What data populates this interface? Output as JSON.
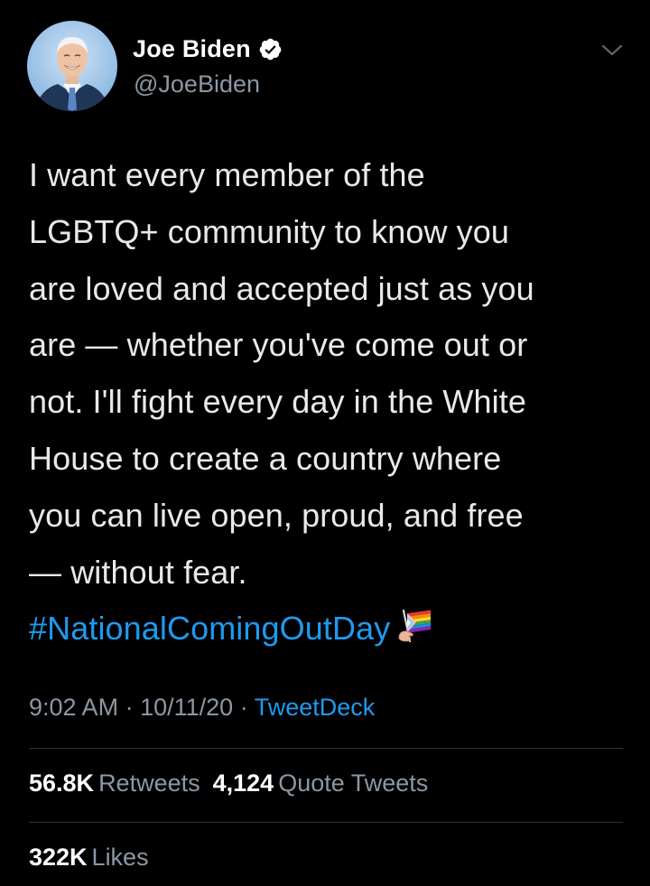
{
  "author": {
    "display_name": "Joe Biden",
    "handle": "@JoeBiden",
    "verified_icon": "verified-badge-icon",
    "more_icon": "chevron-down-icon"
  },
  "tweet": {
    "lines": [
      "I want every member of the",
      "LGBTQ+ community to know you",
      "are loved and accepted just as you",
      "are — whether you've come out or",
      "not. I'll fight every day in the White",
      "House to create a country where",
      "you can live open, proud, and free",
      "— without fear."
    ],
    "hashtag": "#NationalComingOutDay",
    "emoji": "progress-pride-flag-emoji"
  },
  "meta": {
    "time": "9:02 AM",
    "separator": "·",
    "date": "10/11/20",
    "source": "TweetDeck"
  },
  "stats": {
    "retweets_count": "56.8K",
    "retweets_label": "Retweets",
    "quote_count": "4,124",
    "quote_label": "Quote Tweets",
    "likes_count": "322K",
    "likes_label": "Likes"
  },
  "colors": {
    "background": "#000000",
    "text": "#e7e9ea",
    "secondary": "#8b98a5",
    "accent": "#1d9bf0",
    "divider": "#2f3336"
  }
}
